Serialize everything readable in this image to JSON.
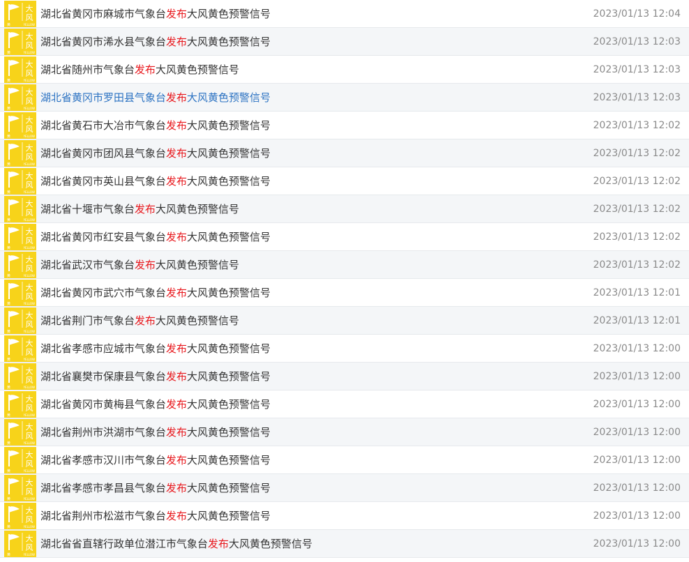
{
  "icon": {
    "name": "gale-yellow-warning-icon",
    "text_line1": "大",
    "text_line2": "风",
    "caption_left": "黄",
    "caption_right": "YELLOW",
    "bg_color": "#f7d31a",
    "fg_color": "#ffffff"
  },
  "colors": {
    "highlight": "#e8161b",
    "hover_link": "#2b72c2",
    "text": "#333333",
    "time": "#8a8a8a",
    "alt_row": "#f4f6f8"
  },
  "alerts": [
    {
      "prefix": "湖北省黄冈市麻城市气象台",
      "keyword": "发布",
      "suffix": "大风黄色预警信号",
      "time": "2023/01/13 12:04"
    },
    {
      "prefix": "湖北省黄冈市浠水县气象台",
      "keyword": "发布",
      "suffix": "大风黄色预警信号",
      "time": "2023/01/13 12:03"
    },
    {
      "prefix": "湖北省随州市气象台",
      "keyword": "发布",
      "suffix": "大风黄色预警信号",
      "time": "2023/01/13 12:03"
    },
    {
      "prefix": "湖北省黄冈市罗田县气象台",
      "keyword": "发布",
      "suffix": "大风黄色预警信号",
      "time": "2023/01/13 12:03",
      "hovered": true
    },
    {
      "prefix": "湖北省黄石市大冶市气象台",
      "keyword": "发布",
      "suffix": "大风黄色预警信号",
      "time": "2023/01/13 12:02"
    },
    {
      "prefix": "湖北省黄冈市团风县气象台",
      "keyword": "发布",
      "suffix": "大风黄色预警信号",
      "time": "2023/01/13 12:02"
    },
    {
      "prefix": "湖北省黄冈市英山县气象台",
      "keyword": "发布",
      "suffix": "大风黄色预警信号",
      "time": "2023/01/13 12:02"
    },
    {
      "prefix": "湖北省十堰市气象台",
      "keyword": "发布",
      "suffix": "大风黄色预警信号",
      "time": "2023/01/13 12:02"
    },
    {
      "prefix": "湖北省黄冈市红安县气象台",
      "keyword": "发布",
      "suffix": "大风黄色预警信号",
      "time": "2023/01/13 12:02"
    },
    {
      "prefix": "湖北省武汉市气象台",
      "keyword": "发布",
      "suffix": "大风黄色预警信号",
      "time": "2023/01/13 12:02"
    },
    {
      "prefix": "湖北省黄冈市武穴市气象台",
      "keyword": "发布",
      "suffix": "大风黄色预警信号",
      "time": "2023/01/13 12:01"
    },
    {
      "prefix": "湖北省荆门市气象台",
      "keyword": "发布",
      "suffix": "大风黄色预警信号",
      "time": "2023/01/13 12:01"
    },
    {
      "prefix": "湖北省孝感市应城市气象台",
      "keyword": "发布",
      "suffix": "大风黄色预警信号",
      "time": "2023/01/13 12:00"
    },
    {
      "prefix": "湖北省襄樊市保康县气象台",
      "keyword": "发布",
      "suffix": "大风黄色预警信号",
      "time": "2023/01/13 12:00"
    },
    {
      "prefix": "湖北省黄冈市黄梅县气象台",
      "keyword": "发布",
      "suffix": "大风黄色预警信号",
      "time": "2023/01/13 12:00"
    },
    {
      "prefix": "湖北省荆州市洪湖市气象台",
      "keyword": "发布",
      "suffix": "大风黄色预警信号",
      "time": "2023/01/13 12:00"
    },
    {
      "prefix": "湖北省孝感市汉川市气象台",
      "keyword": "发布",
      "suffix": "大风黄色预警信号",
      "time": "2023/01/13 12:00"
    },
    {
      "prefix": "湖北省孝感市孝昌县气象台",
      "keyword": "发布",
      "suffix": "大风黄色预警信号",
      "time": "2023/01/13 12:00"
    },
    {
      "prefix": "湖北省荆州市松滋市气象台",
      "keyword": "发布",
      "suffix": "大风黄色预警信号",
      "time": "2023/01/13 12:00"
    },
    {
      "prefix": "湖北省省直辖行政单位潜江市气象台",
      "keyword": "发布",
      "suffix": "大风黄色预警信号",
      "time": "2023/01/13 12:00"
    }
  ]
}
